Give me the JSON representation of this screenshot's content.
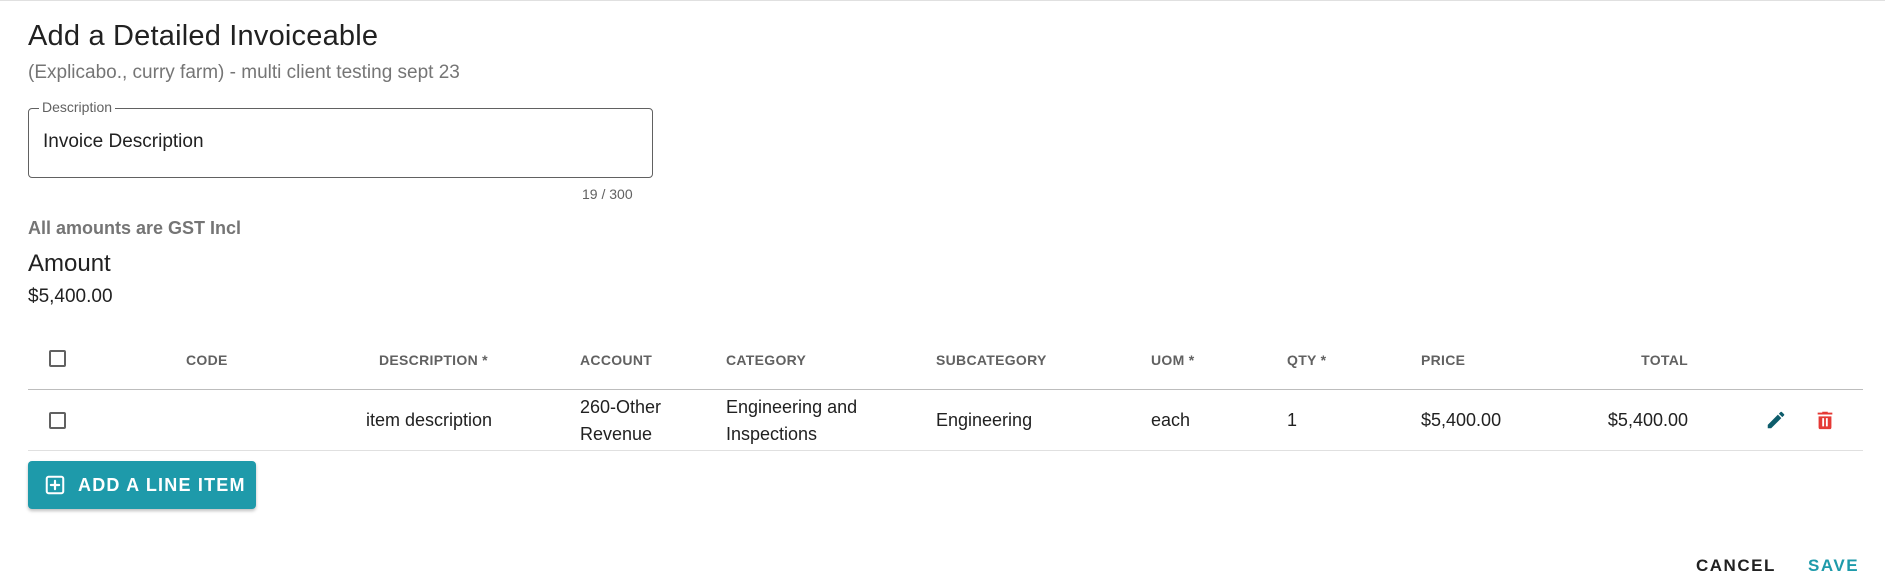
{
  "dialog": {
    "title": "Add a Detailed Invoiceable",
    "subtitle": "(Explicabo., curry farm) - multi client testing sept 23"
  },
  "description_field": {
    "label": "Description",
    "value": "Invoice Description",
    "counter": "19 / 300"
  },
  "gst_note": "All amounts are GST Incl",
  "amount": {
    "heading": "Amount",
    "value": "$5,400.00"
  },
  "table": {
    "headers": {
      "code": "CODE",
      "description": "DESCRIPTION *",
      "account": "ACCOUNT",
      "category": "CATEGORY",
      "subcategory": "SUBCATEGORY",
      "uom": "UOM *",
      "qty": "QTY *",
      "price": "PRICE",
      "total": "TOTAL"
    },
    "rows": [
      {
        "code": "",
        "description": "item description",
        "account_line1": "260-Other",
        "account_line2": "Revenue",
        "category_line1": "Engineering and",
        "category_line2": "Inspections",
        "subcategory": "Engineering",
        "uom": "each",
        "qty": "1",
        "price": "$5,400.00",
        "total": "$5,400.00"
      }
    ]
  },
  "actions": {
    "add_line_item": "ADD A LINE ITEM",
    "cancel": "CANCEL",
    "save": "SAVE"
  },
  "colors": {
    "accent": "#1e9aaa",
    "delete": "#e53935",
    "edit": "#0d5c6b"
  },
  "icons": {
    "edit": "pencil-icon",
    "delete": "trash-icon",
    "add": "plus-box-icon"
  }
}
